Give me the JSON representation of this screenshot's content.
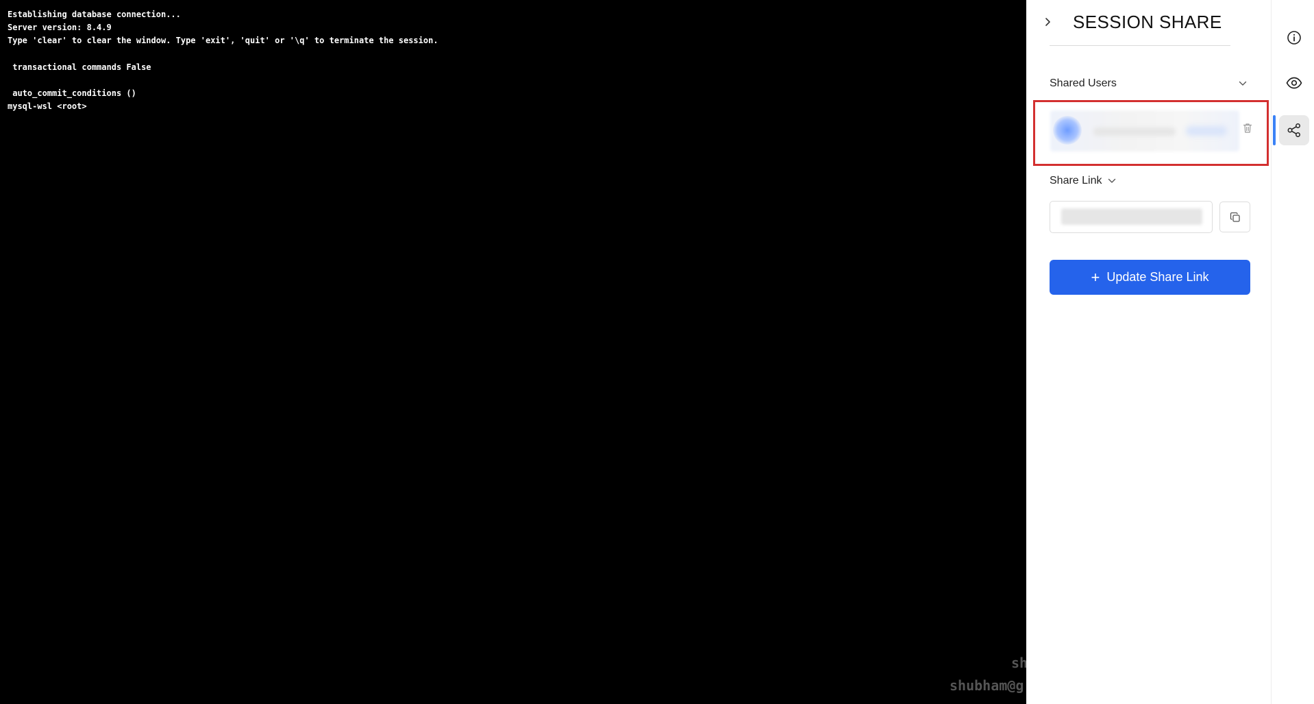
{
  "terminal": {
    "lines": [
      "Establishing database connection...",
      "Server version: 8.4.9",
      "Type 'clear' to clear the window. Type 'exit', 'quit' or '\\q' to terminate the session.",
      "",
      " transactional commands False",
      "",
      " auto_commit_conditions ()",
      "mysql-wsl <root>"
    ],
    "watermark_line1": "sh",
    "watermark_line2": "shubham@g"
  },
  "panel": {
    "title": "SESSION SHARE",
    "shared_users_label": "Shared Users",
    "share_link_label": "Share Link",
    "update_button_label": "Update Share Link",
    "update_button_icon": "+"
  },
  "rail": {
    "items": [
      "info-icon",
      "eye-icon",
      "share-icon"
    ],
    "active": "share-icon"
  },
  "colors": {
    "accent": "#2563eb",
    "highlight_border": "#d32f2f",
    "rail_indicator": "#3b82f6",
    "terminal_bg": "#000000"
  }
}
